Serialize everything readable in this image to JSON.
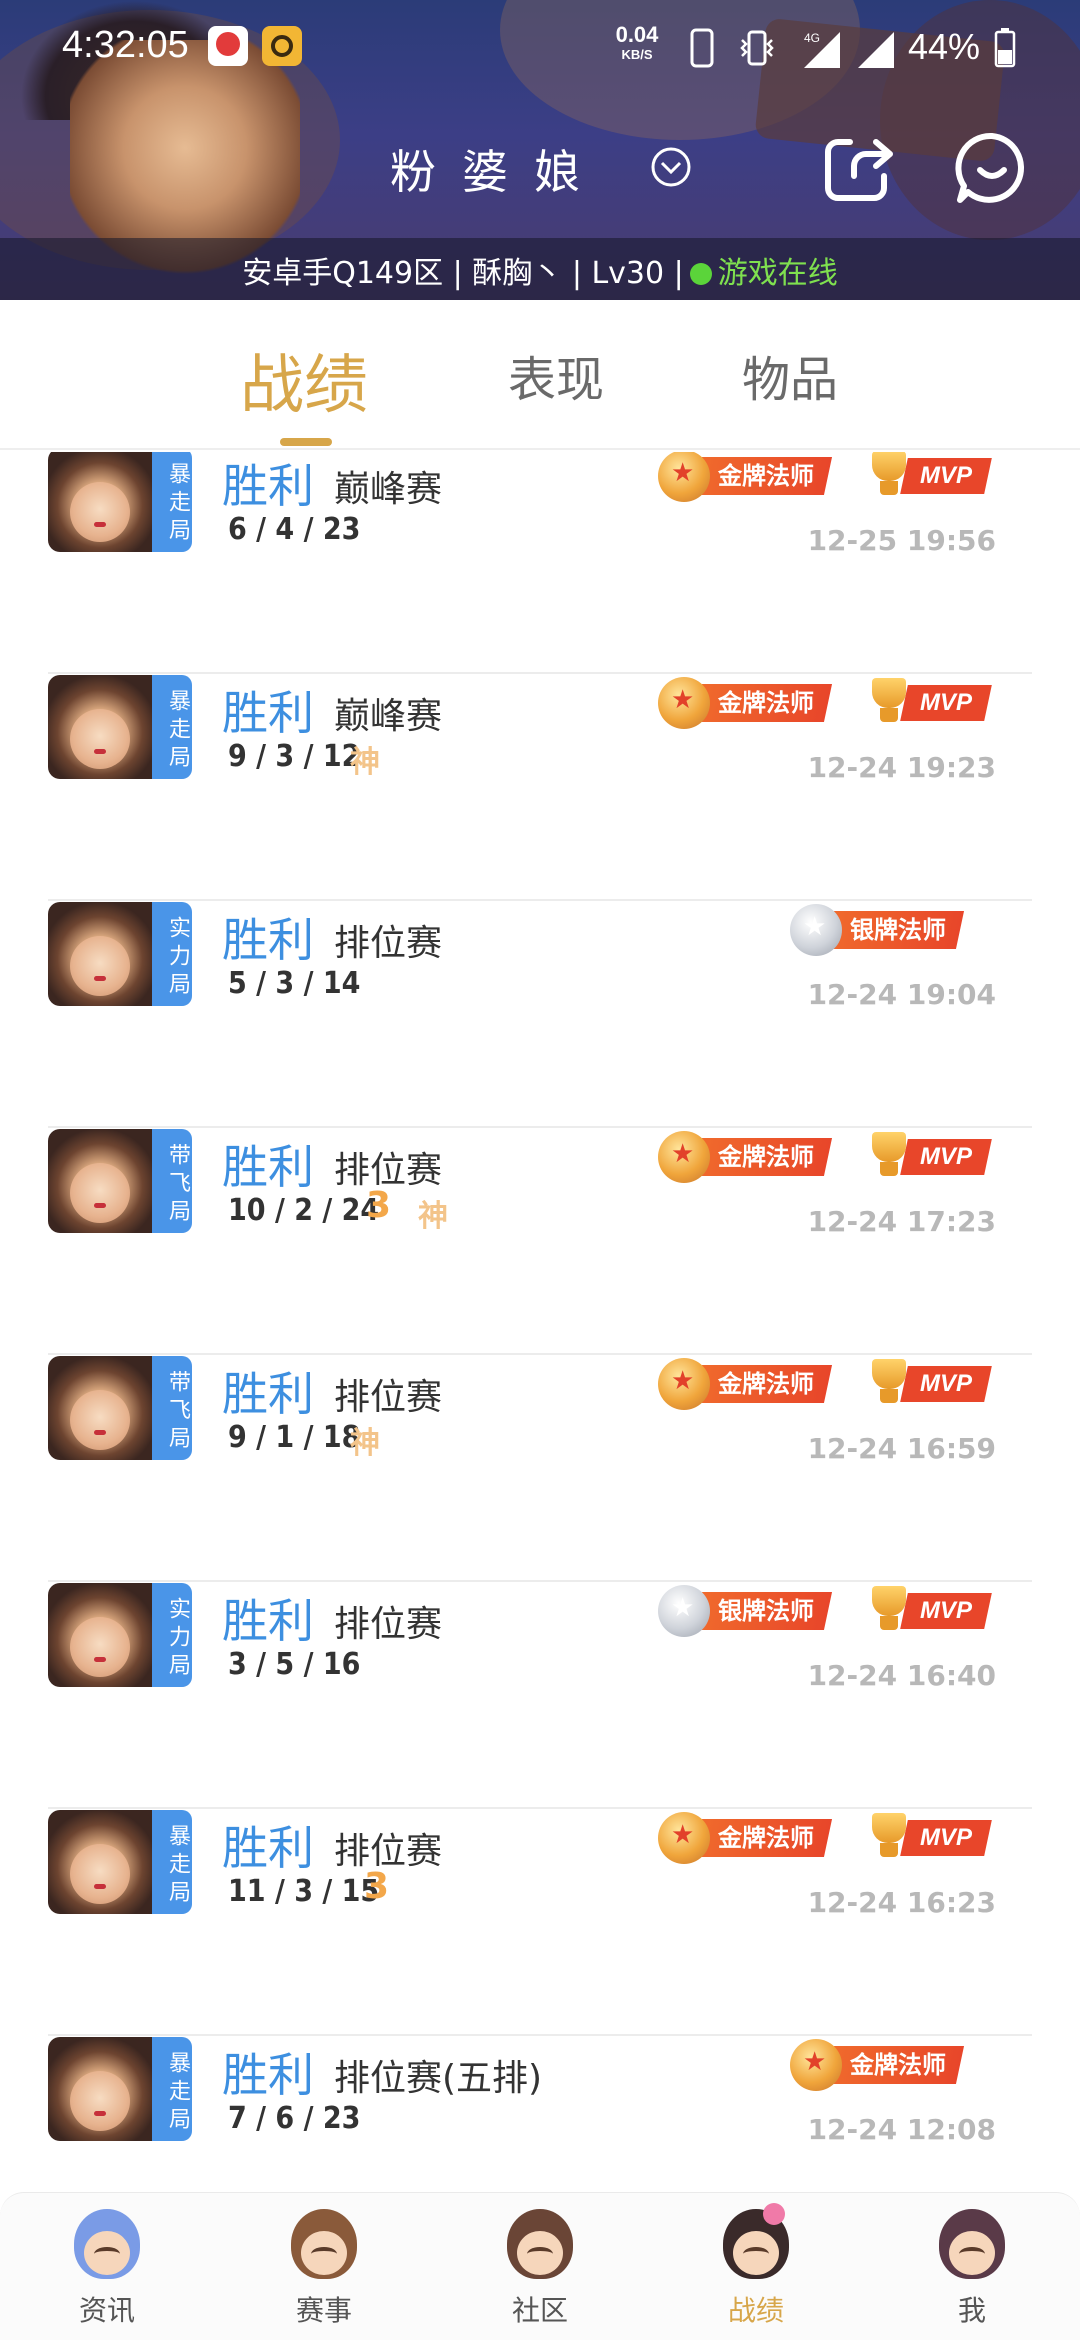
{
  "status_bar": {
    "time": "4:32:05",
    "net_speed_value": "0.04",
    "net_speed_unit": "KB/S",
    "network": "4G",
    "battery": "44%"
  },
  "header": {
    "player_name": "粉婆娘",
    "info_prefix": "安卓手Q149区 | 酥胸丶 | Lv30 |",
    "online_status": "游戏在线"
  },
  "tabs": [
    {
      "label": "战绩",
      "active": true
    },
    {
      "label": "表现",
      "active": false
    },
    {
      "label": "物品",
      "active": false
    }
  ],
  "colors": {
    "accent_gold": "#d7a64a",
    "result_blue": "#3d8fe0",
    "tag_blue": "#4a95e8",
    "online_green": "#5bd43a",
    "ribbon_red": "#e8462a"
  },
  "matches": [
    {
      "tag": "暴走局",
      "result": "胜利",
      "mode": "巅峰赛",
      "kda": "6 / 4 / 23",
      "flags": [],
      "medal": "金牌法师",
      "medal_type": "gold",
      "mvp": "MVP",
      "time": "12-25 19:56"
    },
    {
      "tag": "暴走局",
      "result": "胜利",
      "mode": "巅峰赛",
      "kda": "9 / 3 / 12",
      "flags": [
        "神"
      ],
      "medal": "金牌法师",
      "medal_type": "gold",
      "mvp": "MVP",
      "time": "12-24 19:23"
    },
    {
      "tag": "实力局",
      "result": "胜利",
      "mode": "排位赛",
      "kda": "5 / 3 / 14",
      "flags": [],
      "medal": "银牌法师",
      "medal_type": "silver",
      "mvp": "",
      "time": "12-24 19:04"
    },
    {
      "tag": "带飞局",
      "result": "胜利",
      "mode": "排位赛",
      "kda": "10 / 2 / 24",
      "flags": [
        "3",
        "神"
      ],
      "medal": "金牌法师",
      "medal_type": "gold",
      "mvp": "MVP",
      "time": "12-24 17:23"
    },
    {
      "tag": "带飞局",
      "result": "胜利",
      "mode": "排位赛",
      "kda": "9 / 1 / 18",
      "flags": [
        "神"
      ],
      "medal": "金牌法师",
      "medal_type": "gold",
      "mvp": "MVP",
      "time": "12-24 16:59"
    },
    {
      "tag": "实力局",
      "result": "胜利",
      "mode": "排位赛",
      "kda": "3 / 5 / 16",
      "flags": [],
      "medal": "银牌法师",
      "medal_type": "silver",
      "mvp": "MVP",
      "time": "12-24 16:40"
    },
    {
      "tag": "暴走局",
      "result": "胜利",
      "mode": "排位赛",
      "kda": "11 / 3 / 15",
      "flags": [
        "3"
      ],
      "medal": "金牌法师",
      "medal_type": "gold",
      "mvp": "MVP",
      "time": "12-24 16:23"
    },
    {
      "tag": "暴走局",
      "result": "胜利",
      "mode": "排位赛(五排)",
      "kda": "7 / 6 / 23",
      "flags": [],
      "medal": "金牌法师",
      "medal_type": "gold",
      "mvp": "",
      "time": "12-24 12:08"
    }
  ],
  "bottom_nav": [
    {
      "label": "资讯",
      "icon": "news-avatar-icon",
      "active": false
    },
    {
      "label": "赛事",
      "icon": "events-avatar-icon",
      "active": false
    },
    {
      "label": "社区",
      "icon": "community-avatar-icon",
      "active": false
    },
    {
      "label": "战绩",
      "icon": "record-avatar-icon",
      "active": true
    },
    {
      "label": "我",
      "icon": "me-avatar-icon",
      "active": false
    }
  ]
}
